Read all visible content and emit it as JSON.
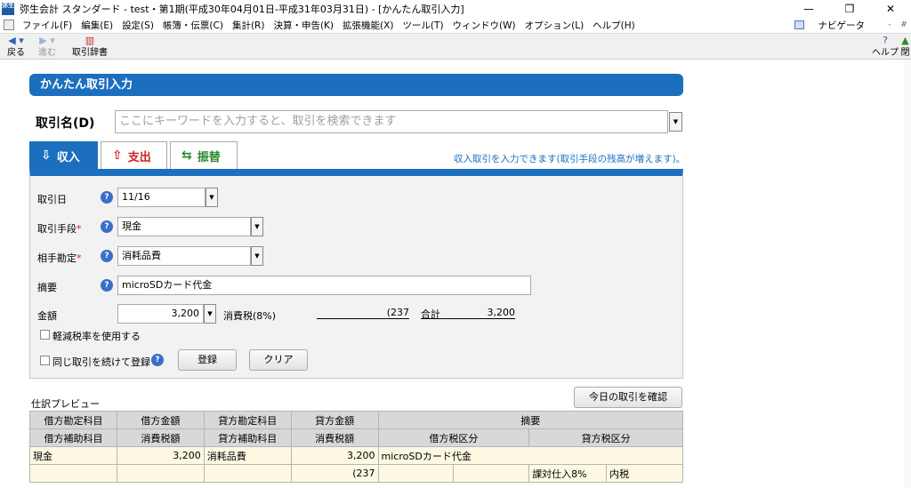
{
  "window": {
    "app_icon_text": "弥生",
    "title": "弥生会計 スタンダード - test・第1期(平成30年04月01日-平成31年03月31日) - [かんたん取引入力]",
    "controls": [
      "—",
      "❐",
      "✕"
    ]
  },
  "menubar": {
    "items": [
      "ファイル(F)",
      "編集(E)",
      "設定(S)",
      "帳簿・伝票(C)",
      "集計(R)",
      "決算・申告(K)",
      "拡張機能(X)",
      "ツール(T)",
      "ウィンドウ(W)",
      "オプション(L)",
      "ヘルプ(H)"
    ],
    "navigator_label": "ナビゲータ",
    "mdi_controls": [
      "-",
      "#"
    ]
  },
  "toolbar": {
    "back": "戻る",
    "forward": "進む",
    "dictionary": "取引辞書",
    "help": "ヘルプ",
    "close": "閉"
  },
  "page": {
    "title": "かんたん取引入力",
    "transaction_name_label": "取引名(D)",
    "search_placeholder": "ここにキーワードを入力すると、取引を検索できます"
  },
  "tabs": {
    "income": "収入",
    "expense": "支出",
    "transfer": "振替",
    "hint": "収入取引を入力できます(取引手段の残高が増えます)。"
  },
  "form": {
    "date_label": "取引日",
    "date_value": "11/16",
    "method_label": "取引手段",
    "method_value": "現金",
    "account_label": "相手勘定",
    "account_value": "消耗品費",
    "summary_label": "摘要",
    "summary_value": "microSDカード代金",
    "amount_label": "金額",
    "amount_value": "3,200",
    "tax_label": "消費税(8%)",
    "tax_value": "(237",
    "total_label": "合計",
    "total_value": "3,200",
    "reduced_rate_label": "軽減税率を使用する",
    "continue_label": "同じ取引を続けて登録",
    "register_button": "登録",
    "clear_button": "クリア",
    "required_mark": "*"
  },
  "preview": {
    "label": "仕訳プレビュー",
    "today_button": "今日の取引を確認",
    "header_row1": [
      "借方勘定科目",
      "借方金額",
      "貸方勘定科目",
      "貸方金額",
      "摘要"
    ],
    "header_row2": [
      "借方補助科目",
      "消費税額",
      "貸方補助科目",
      "消費税額",
      "借方税区分",
      "貸方税区分"
    ],
    "row1": {
      "debit_account": "現金",
      "debit_amount": "3,200",
      "credit_account": "消耗品費",
      "credit_amount": "3,200",
      "summary": "microSDカード代金"
    },
    "row2": {
      "credit_tax": "(237",
      "credit_tax_class": "課対仕入8%",
      "tax_type": "内税"
    }
  },
  "colors": {
    "accent_blue": "#1c6fbf",
    "expense_red": "#d22020",
    "transfer_green": "#2a8a2a",
    "row_highlight": "#fdf8e2"
  }
}
